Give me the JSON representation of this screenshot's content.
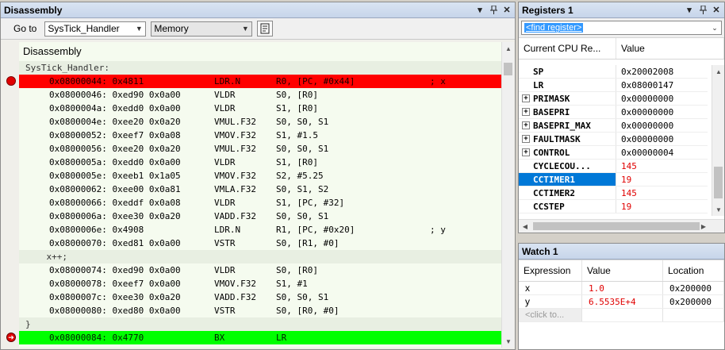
{
  "disassembly": {
    "title": "Disassembly",
    "goto_label": "Go to",
    "goto_value": "SysTick_Handler",
    "memory_value": "Memory",
    "heading": "Disassembly",
    "lines": [
      {
        "kind": "src",
        "text": "SysTick_Handler:"
      },
      {
        "kind": "asm",
        "hl": "red",
        "marker": "breakpoint",
        "addr": "0x08000044: 0x4811",
        "op": "LDR.N",
        "args": "R0, [PC, #0x44]",
        "comment": "; x"
      },
      {
        "kind": "asm",
        "addr": "0x08000046: 0xed90 0x0a00",
        "op": "VLDR",
        "args": "S0, [R0]"
      },
      {
        "kind": "asm",
        "addr": "0x0800004a: 0xedd0 0x0a00",
        "op": "VLDR",
        "args": "S1, [R0]"
      },
      {
        "kind": "asm",
        "addr": "0x0800004e: 0xee20 0x0a20",
        "op": "VMUL.F32",
        "args": "S0, S0, S1"
      },
      {
        "kind": "asm",
        "addr": "0x08000052: 0xeef7 0x0a08",
        "op": "VMOV.F32",
        "args": "S1, #1.5"
      },
      {
        "kind": "asm",
        "addr": "0x08000056: 0xee20 0x0a20",
        "op": "VMUL.F32",
        "args": "S0, S0, S1"
      },
      {
        "kind": "asm",
        "addr": "0x0800005a: 0xedd0 0x0a00",
        "op": "VLDR",
        "args": "S1, [R0]"
      },
      {
        "kind": "asm",
        "addr": "0x0800005e: 0xeeb1 0x1a05",
        "op": "VMOV.F32",
        "args": "S2, #5.25"
      },
      {
        "kind": "asm",
        "addr": "0x08000062: 0xee00 0x0a81",
        "op": "VMLA.F32",
        "args": "S0, S1, S2"
      },
      {
        "kind": "asm",
        "addr": "0x08000066: 0xeddf 0x0a08",
        "op": "VLDR",
        "args": "S1, [PC, #32]"
      },
      {
        "kind": "asm",
        "addr": "0x0800006a: 0xee30 0x0a20",
        "op": "VADD.F32",
        "args": "S0, S0, S1"
      },
      {
        "kind": "asm",
        "addr": "0x0800006e: 0x4908",
        "op": "LDR.N",
        "args": "R1, [PC, #0x20]",
        "comment": "; y"
      },
      {
        "kind": "asm",
        "addr": "0x08000070: 0xed81 0x0a00",
        "op": "VSTR",
        "args": "S0, [R1, #0]"
      },
      {
        "kind": "src",
        "text": "    x++;"
      },
      {
        "kind": "asm",
        "addr": "0x08000074: 0xed90 0x0a00",
        "op": "VLDR",
        "args": "S0, [R0]"
      },
      {
        "kind": "asm",
        "addr": "0x08000078: 0xeef7 0x0a00",
        "op": "VMOV.F32",
        "args": "S1, #1"
      },
      {
        "kind": "asm",
        "addr": "0x0800007c: 0xee30 0x0a20",
        "op": "VADD.F32",
        "args": "S0, S0, S1"
      },
      {
        "kind": "asm",
        "addr": "0x08000080: 0xed80 0x0a00",
        "op": "VSTR",
        "args": "S0, [R0, #0]"
      },
      {
        "kind": "src",
        "text": "}"
      },
      {
        "kind": "asm",
        "hl": "green",
        "marker": "current-pc",
        "addr": "0x08000084: 0x4770",
        "op": "BX",
        "args": "LR"
      }
    ]
  },
  "registers": {
    "title": "Registers 1",
    "find_placeholder": "<find register>",
    "col_name": "Current CPU Re...",
    "col_value": "Value",
    "rows": [
      {
        "name": "SP",
        "value": "0x20002008"
      },
      {
        "name": "LR",
        "value": "0x08000147"
      },
      {
        "name": "PRIMASK",
        "value": "0x00000000",
        "expand": true
      },
      {
        "name": "BASEPRI",
        "value": "0x00000000",
        "expand": true
      },
      {
        "name": "BASEPRI_MAX",
        "value": "0x00000000",
        "expand": true
      },
      {
        "name": "FAULTMASK",
        "value": "0x00000000",
        "expand": true
      },
      {
        "name": "CONTROL",
        "value": "0x00000004",
        "expand": true
      },
      {
        "name": "CYCLECOU...",
        "value": "145",
        "changed": true
      },
      {
        "name": "CCTIMER1",
        "value": "19",
        "changed": true,
        "selected": true
      },
      {
        "name": "CCTIMER2",
        "value": "145",
        "changed": true
      },
      {
        "name": "CCSTEP",
        "value": "19",
        "changed": true
      }
    ]
  },
  "watch": {
    "title": "Watch 1",
    "col_expr": "Expression",
    "col_value": "Value",
    "col_loc": "Location",
    "rows": [
      {
        "expr": "x",
        "value": "1.0",
        "loc": "0x200000"
      },
      {
        "expr": "y",
        "value": "6.5535E+4",
        "loc": "0x200000"
      }
    ],
    "click_to": "<click to..."
  },
  "icons": {
    "pin": "pin-icon",
    "dropdown": "chevron-down-icon",
    "close": "close-icon",
    "breakpoint": "breakpoint-icon",
    "pc": "current-pc-icon"
  },
  "colors": {
    "breakpoint_line": "#ff0000",
    "pc_line": "#00ff00",
    "changed_value": "#e00000",
    "selection": "#0078d7"
  }
}
